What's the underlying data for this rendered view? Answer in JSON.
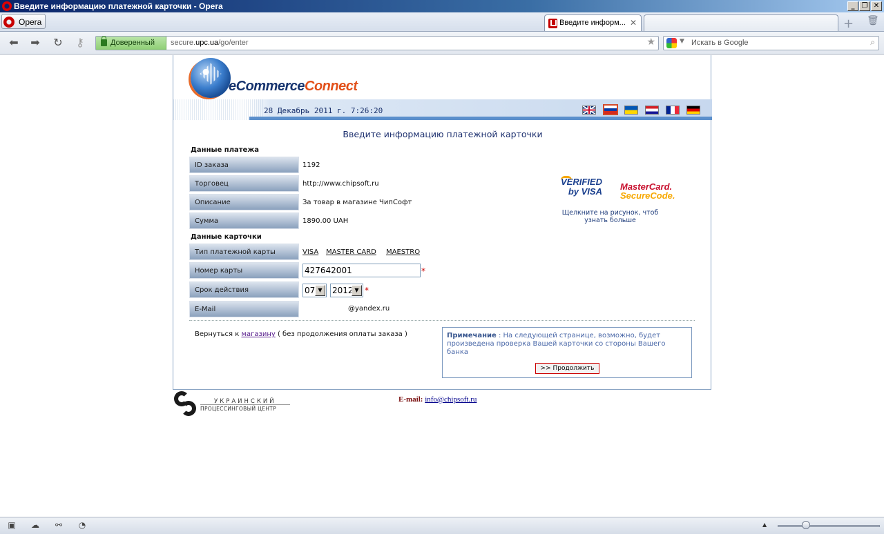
{
  "window": {
    "title": "Введите информацию платежной карточки - Opera",
    "menu_label": "Opera"
  },
  "tabs": [
    {
      "label": "Введите информ...",
      "active": true
    }
  ],
  "address": {
    "trust_label": "Доверенный",
    "url_prefix": "secure.",
    "url_domain": "upc.ua",
    "url_path": "/go/enter",
    "search_placeholder": "Искать в Google"
  },
  "page": {
    "brand_e": "eCommerce",
    "brand_c": "Connect",
    "datetime": "28 Декабрь 2011 г. 7:26:20",
    "languages": [
      "en",
      "ru",
      "ua",
      "hr",
      "fr",
      "de"
    ],
    "form_title": "Введите информацию платежной карточки",
    "payment_section": "Данные платежа",
    "card_section": "Данные карточки",
    "payment_fields": [
      {
        "label": "ID заказа",
        "value": "1192"
      },
      {
        "label": "Торговец",
        "value": "http://www.chipsoft.ru"
      },
      {
        "label": "Описание",
        "value": "За товар в магазине ЧипСофт"
      },
      {
        "label": "Сумма",
        "value": "1890.00 UAH"
      }
    ],
    "card_type_label": "Тип платежной карты",
    "card_types": [
      "VISA",
      "MASTER CARD",
      "MAESTRO"
    ],
    "card_number_label": "Номер карты",
    "card_number_value": "427642001",
    "expiry_label": "Срок действия",
    "expiry_month": "07",
    "expiry_year": "2012",
    "email_label": "E-Mail",
    "email_value": "@yandex.ru",
    "required_mark": "*",
    "return_prefix": "Вернуться к ",
    "return_link": "магазину",
    "return_suffix": " ( без продолжения оплаты заказа )",
    "note_label": "Примечание",
    "note_text": " : На следующей странице, возможно, будет произведена проверка Вашей карточки со стороны Вашего банка",
    "continue_button": ">> Продолжить",
    "vbv_top": "VERIFIED",
    "vbv_bottom": "by VISA",
    "mc_top": "MasterCard.",
    "mc_bottom": "SecureCode.",
    "secure_info": "Щелкните на рисунок, чтоб узнать больше"
  },
  "footer": {
    "upc_line1": "УКРАИНСКИЙ",
    "upc_line2": "ПРОЦЕССИНГОВЫЙ ЦЕНТР",
    "email_label": "E-mail:",
    "email_link": "info@chipsoft.ru"
  },
  "colors": {
    "title_gradient_start": "#0a246a",
    "brand_blue": "#16336e",
    "brand_orange": "#e2501a",
    "trust_green": "#8fcf75"
  }
}
